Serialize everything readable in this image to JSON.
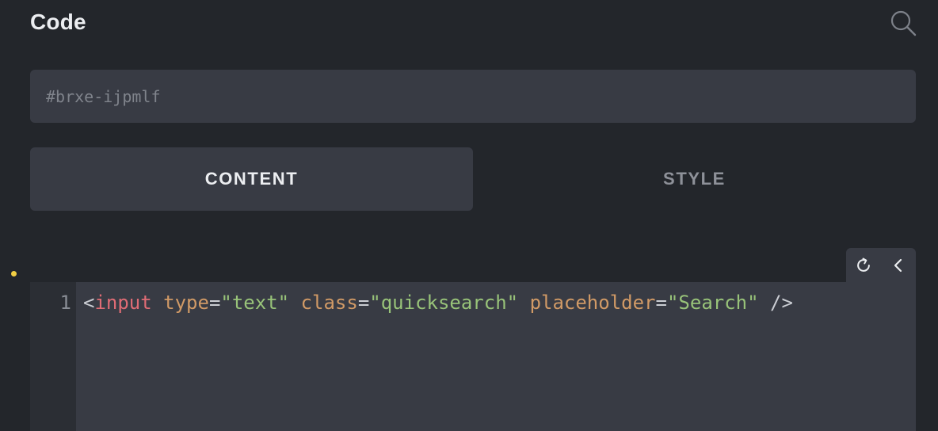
{
  "panel": {
    "title": "Code"
  },
  "icons": {
    "search": "search-icon",
    "refresh": "refresh-icon",
    "collapse": "chevron-left-icon"
  },
  "id_field": {
    "placeholder": "#brxe-ijpmlf"
  },
  "tabs": [
    {
      "label": "CONTENT",
      "active": true
    },
    {
      "label": "STYLE",
      "active": false
    }
  ],
  "editor": {
    "line_numbers": [
      "1"
    ],
    "tokens": {
      "open": "<",
      "tag": "input",
      "attr1_name": "type",
      "attr1_eq": "=",
      "attr1_value": "\"text\"",
      "attr2_name": "class",
      "attr2_eq": "=",
      "attr2_value": "\"quicksearch\"",
      "attr3_name": "placeholder",
      "attr3_eq": "=",
      "attr3_value": "\"Search\"",
      "close": "/>"
    }
  },
  "colors": {
    "background": "#23262b",
    "surface": "#383b44",
    "gutter": "#2b2e34",
    "modified_dot": "#f2cf44",
    "syntax_tag": "#e06c75",
    "syntax_attr": "#d19a66",
    "syntax_string": "#98c379"
  }
}
